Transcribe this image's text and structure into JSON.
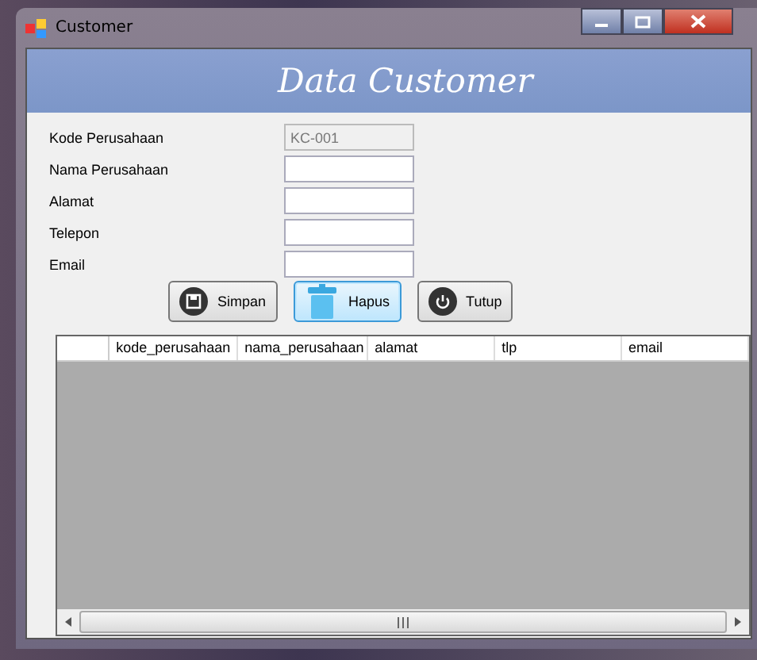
{
  "window": {
    "title": "Customer"
  },
  "banner": {
    "title": "Data Customer"
  },
  "fields": [
    {
      "label": "Kode Perusahaan",
      "value": "KC-001",
      "disabled": true
    },
    {
      "label": "Nama Perusahaan",
      "disabled": false
    },
    {
      "label": "Alamat",
      "disabled": false
    },
    {
      "label": "Telepon",
      "disabled": false
    },
    {
      "label": "Email",
      "disabled": false
    }
  ],
  "buttons": [
    {
      "label": "Simpan",
      "kind": "save",
      "focused": false
    },
    {
      "label": "Hapus",
      "kind": "delete",
      "focused": true
    },
    {
      "label": "Tutup",
      "kind": "power",
      "focused": false
    }
  ],
  "table": {
    "columns": [
      "kode_perusahaan",
      "nama_perusahaan",
      "alamat",
      "tlp",
      "email"
    ]
  }
}
